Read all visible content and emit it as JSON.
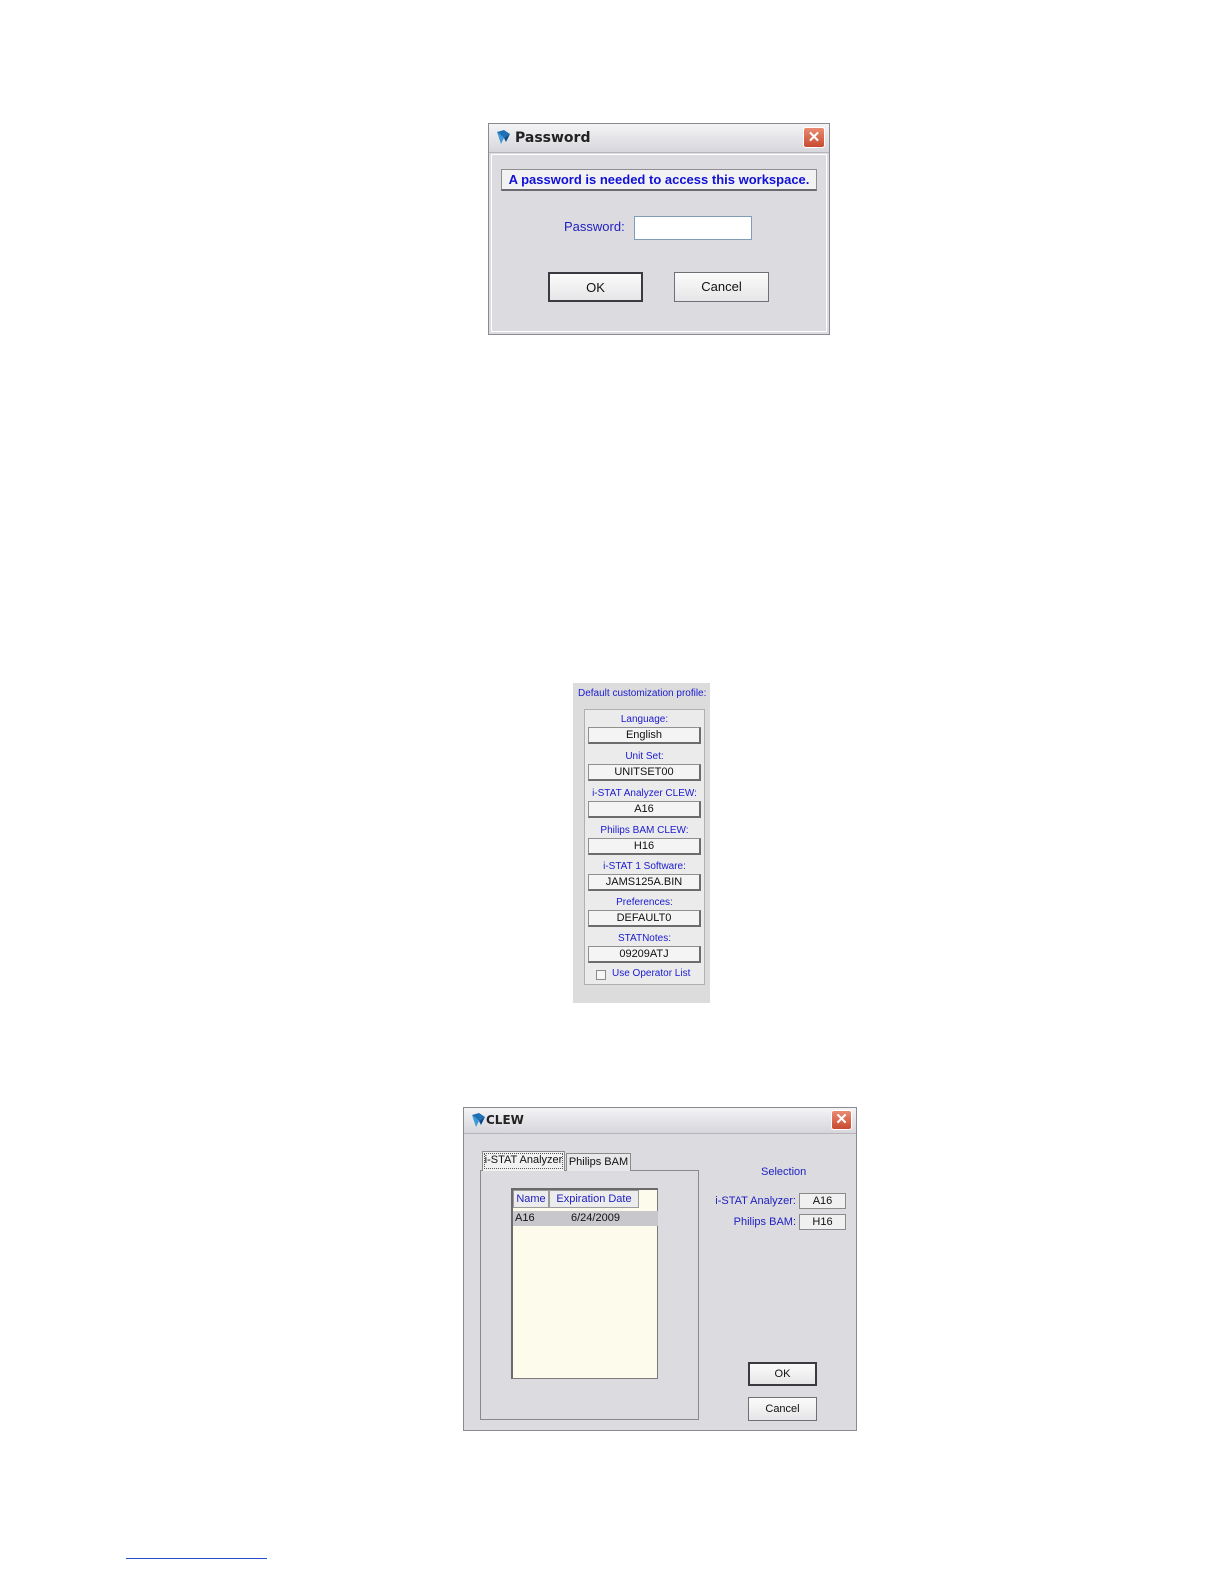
{
  "password_dialog": {
    "title": "Password",
    "message": "A password is needed to access this workspace.",
    "password_label": "Password:",
    "password_value": "",
    "ok_label": "OK",
    "cancel_label": "Cancel",
    "close_glyph": "✕",
    "icons": [
      "app-icon",
      "close-icon"
    ]
  },
  "profile_panel": {
    "title": "Default customization profile:",
    "fields": [
      {
        "label": "Language:",
        "value": "English"
      },
      {
        "label": "Unit Set:",
        "value": "UNITSET00"
      },
      {
        "label": "i-STAT Analyzer CLEW:",
        "value": "A16"
      },
      {
        "label": "Philips BAM CLEW:",
        "value": "H16"
      },
      {
        "label": "i-STAT 1 Software:",
        "value": "JAMS125A.BIN"
      },
      {
        "label": "Preferences:",
        "value": "DEFAULT0"
      },
      {
        "label": "STATNotes:",
        "value": "09209ATJ"
      }
    ],
    "use_operator_list_label": "Use Operator List",
    "use_operator_list_checked": false
  },
  "clew_dialog": {
    "title": "CLEW",
    "close_glyph": "✕",
    "tabs": [
      {
        "label": "i-STAT Analyzer",
        "active": true
      },
      {
        "label": "Philips BAM",
        "active": false
      }
    ],
    "table": {
      "columns": [
        "Name",
        "Expiration Date"
      ],
      "rows": [
        {
          "name": "A16",
          "expiration_date": "6/24/2009",
          "selected": true
        }
      ]
    },
    "selection": {
      "title": "Selection",
      "istat_label": "i-STAT Analyzer:",
      "istat_value": "A16",
      "philips_label": "Philips BAM:",
      "philips_value": "H16"
    },
    "ok_label": "OK",
    "cancel_label": "Cancel"
  },
  "colors": {
    "dialog_bg": "#dcdce0",
    "label_blue": "#2020c0",
    "close_red": "#c84a30",
    "list_bg": "#fdfbec"
  }
}
